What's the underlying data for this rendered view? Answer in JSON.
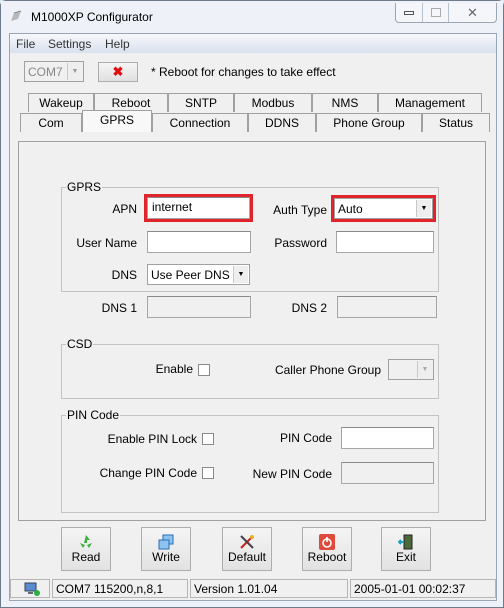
{
  "window": {
    "title": "M1000XP Configurator",
    "caption_buttons": {
      "minimize": "minimize",
      "maximize": "maximize",
      "close": "close"
    }
  },
  "menu": [
    "File",
    "Settings",
    "Help"
  ],
  "toolbar": {
    "port_value": "COM7",
    "disconnect_icon": "red-x",
    "notice": "* Reboot for changes to take effect"
  },
  "tabs": {
    "row_top": [
      "Wakeup",
      "Reboot",
      "SNTP",
      "Modbus",
      "NMS",
      "Management"
    ],
    "row_bottom": [
      "Com",
      "GPRS",
      "Connection",
      "DDNS",
      "Phone Group",
      "Status"
    ],
    "active": "GPRS"
  },
  "gprs": {
    "legend": "GPRS",
    "apn_label": "APN",
    "apn_value": "internet",
    "auth_type_label": "Auth Type",
    "auth_type_value": "Auto",
    "user_name_label": "User Name",
    "user_name_value": "",
    "password_label": "Password",
    "password_value": "",
    "dns_label": "DNS",
    "dns_value": "Use Peer DNS",
    "dns1_label": "DNS 1",
    "dns1_value": "",
    "dns2_label": "DNS 2",
    "dns2_value": ""
  },
  "csd": {
    "legend": "CSD",
    "enable_label": "Enable",
    "enable_checked": false,
    "caller_group_label": "Caller Phone Group",
    "caller_group_value": ""
  },
  "pin": {
    "legend": "PIN Code",
    "enable_lock_label": "Enable PIN Lock",
    "enable_lock_checked": false,
    "change_pin_label": "Change PIN Code",
    "change_pin_checked": false,
    "pin_code_label": "PIN Code",
    "pin_code_value": "",
    "new_pin_label": "New PIN Code",
    "new_pin_value": ""
  },
  "buttons": {
    "read": "Read",
    "write": "Write",
    "default": "Default",
    "reboot": "Reboot",
    "exit": "Exit"
  },
  "statusbar": {
    "connection": "COM7 115200,n,8,1",
    "version": "Version 1.01.04",
    "datetime": "2005-01-01 00:02:37"
  },
  "colors": {
    "highlight": "#e0242b"
  }
}
